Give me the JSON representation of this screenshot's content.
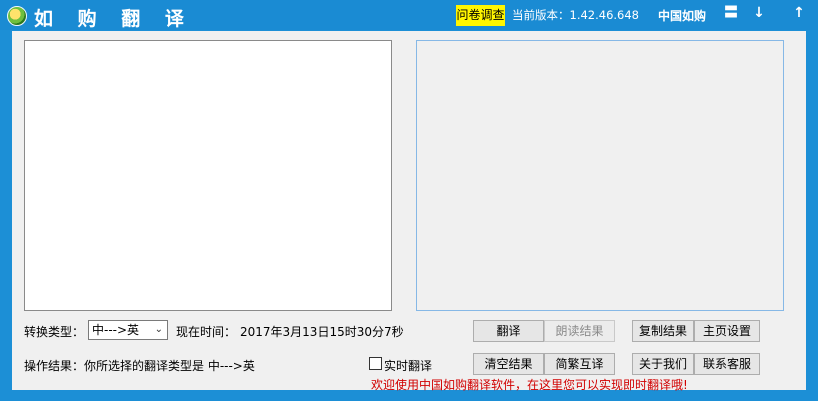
{
  "titlebar": {
    "title": "如 购 翻 译",
    "survey_label": "问卷调查",
    "version_text": "当前版本：1.42.46.648",
    "brand_label": "中国如购",
    "menu_glyph": "〓",
    "minimize_glyph": "↓",
    "pin_glyph": "↑"
  },
  "main": {
    "input_text": "",
    "output_text": "",
    "convert_type_label": "转换类型：",
    "convert_type_value": "中--->英",
    "current_time_label": "现在时间：",
    "current_time_value": "2017年3月13日15时30分7秒",
    "result_label": "操作结果：你所选择的翻译类型是   中--->英",
    "realtime_label": "实时翻译",
    "realtime_checked": false,
    "buttons": {
      "translate": "翻译",
      "read_result": "朗读结果",
      "copy_result": "复制结果",
      "home_settings": "主页设置",
      "clear_result": "清空结果",
      "simp_trad": "简繁互译",
      "about_us": "关于我们",
      "contact_service": "联系客服"
    },
    "welcome_text": "欢迎使用中国如购翻译软件，在这里您可以实现即时翻译哦!"
  },
  "colors": {
    "titlebar": "#1a8bd3",
    "survey_bg": "#fff600",
    "welcome_text": "#d10000"
  }
}
